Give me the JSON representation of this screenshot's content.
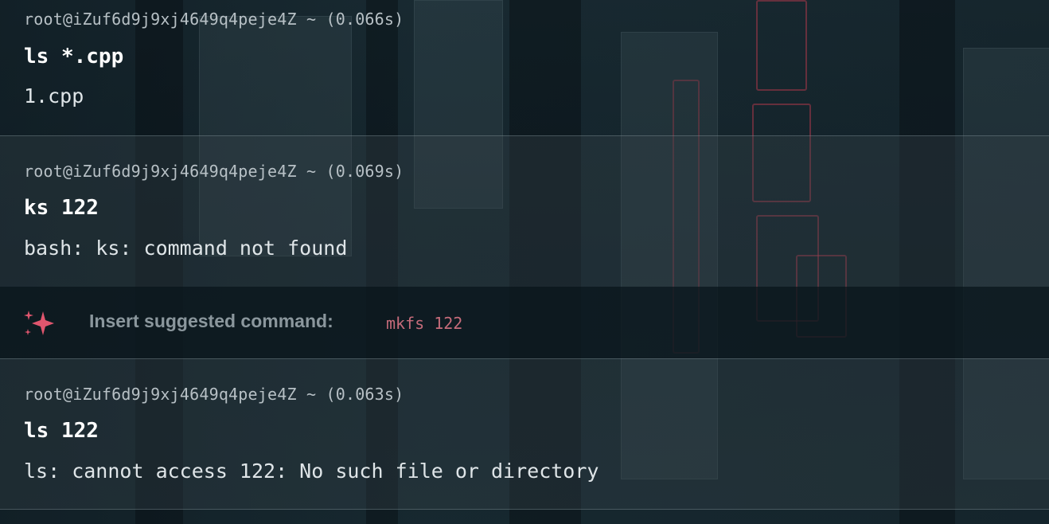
{
  "blocks": [
    {
      "prompt": "root@iZuf6d9j9xj4649q4peje4Z ~ (0.066s)",
      "command": "ls *.cpp",
      "output": "1.cpp"
    },
    {
      "prompt": "root@iZuf6d9j9xj4649q4peje4Z ~ (0.069s)",
      "command": "ks 122",
      "output": "bash: ks: command not found"
    },
    {
      "prompt": "root@iZuf6d9j9xj4649q4peje4Z ~ (0.063s)",
      "command": "ls 122",
      "output": "ls: cannot access 122: No such file or directory"
    }
  ],
  "suggestion": {
    "icon": "sparkle-icon",
    "label": "Insert suggested command:",
    "command": "mkfs 122"
  },
  "colors": {
    "accent": "#e0566e",
    "suggested_command": "#c56b7a",
    "background": "#17262d"
  }
}
